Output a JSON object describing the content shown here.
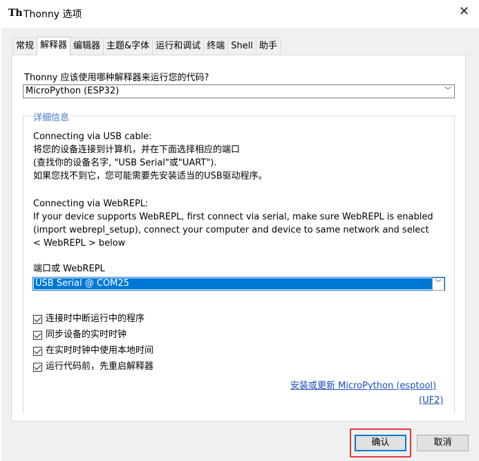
{
  "window": {
    "title": "Thonny 选项",
    "logo_text": "Th"
  },
  "tabs": [
    "常规",
    "解释器",
    "编辑器",
    "主题&字体",
    "运行和调试",
    "终端",
    "Shell",
    "助手"
  ],
  "active_tab": "解释器",
  "interpreter": {
    "question": "Thonny 应该使用哪种解释器来运行您的代码?",
    "selected": "MicroPython (ESP32)"
  },
  "details": {
    "title": "详细信息",
    "usb_lines": [
      "Connecting via USB cable:",
      "将您的设备连接到计算机，并在下面选择相应的端口",
      "(查找你的设备名字, \"USB Serial\"或\"UART\").",
      "如果您找不到它，您可能需要先安装适当的USB驱动程序。"
    ],
    "webrepl_lines": [
      "Connecting via WebREPL:",
      "If your device supports WebREPL, first connect via serial, make sure WebREPL is enabled",
      "(import webrepl_setup), connect your computer and device to same network and select",
      "< WebREPL > below"
    ],
    "port_label": "端口或 WebREPL",
    "port_selected": "USB Serial @ COM25",
    "checkboxes": [
      {
        "label": "连接时中断运行中的程序",
        "checked": true
      },
      {
        "label": "同步设备的实时时钟",
        "checked": true
      },
      {
        "label": "在实时时钟中使用本地时间",
        "checked": true
      },
      {
        "label": "运行代码前，先重启解释器",
        "checked": true
      }
    ],
    "link_install": "安装或更新 MicroPython (esptool)",
    "link_uf2": "(UF2)"
  },
  "buttons": {
    "ok": "确认",
    "cancel": "取消"
  },
  "colors": {
    "accent": "#0078d7",
    "link": "#1a4dbb",
    "group_title": "#3c78c8",
    "highlight": "#e0383e"
  }
}
